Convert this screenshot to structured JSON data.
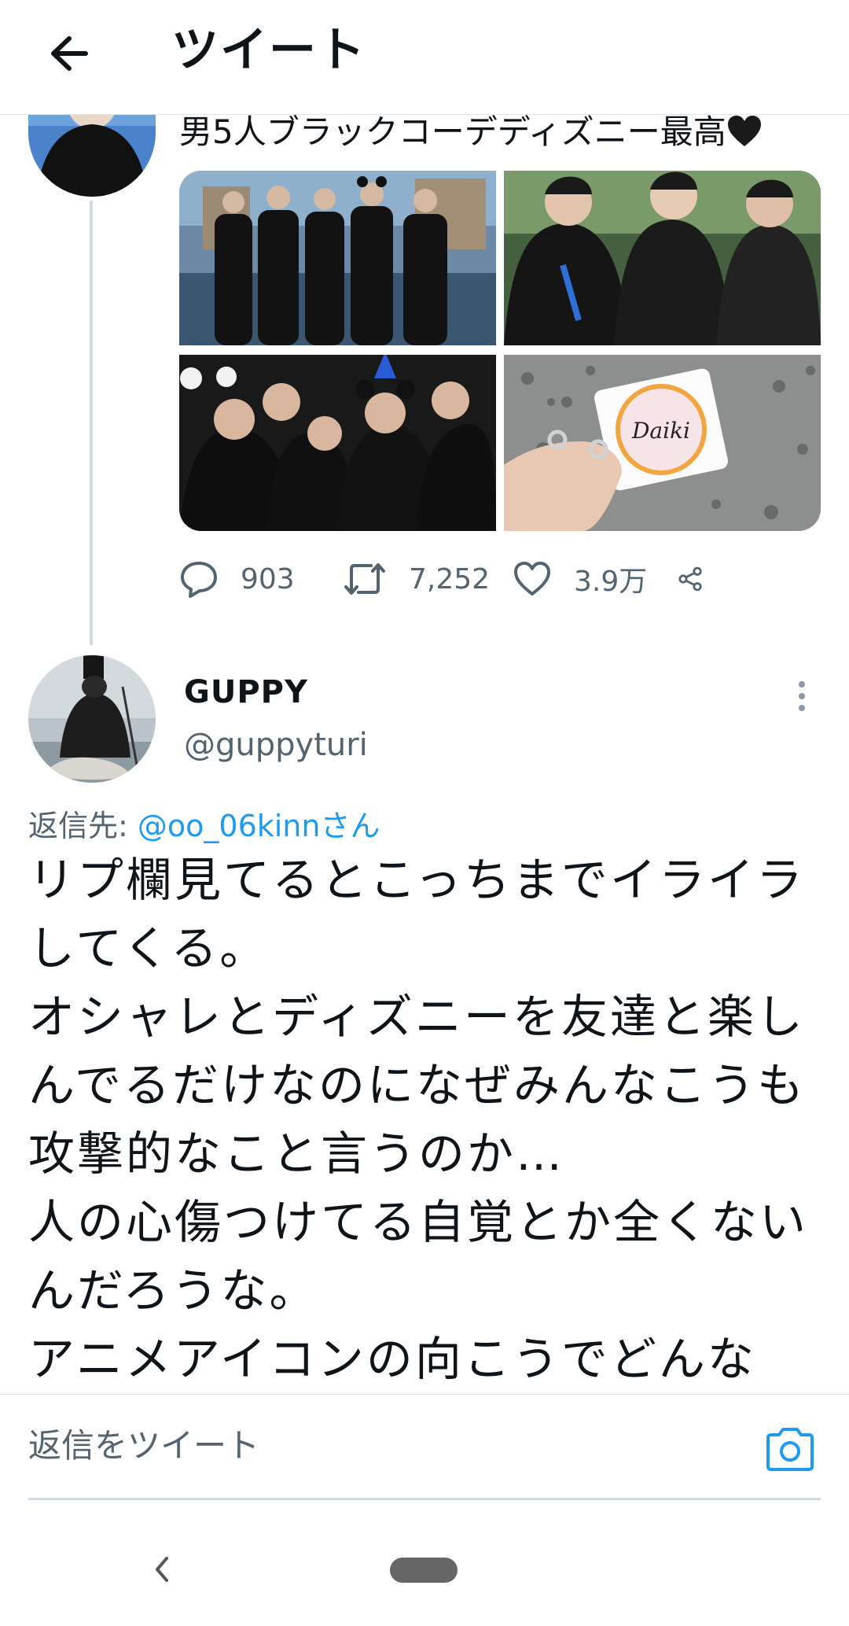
{
  "header": {
    "title": "ツイート",
    "back_icon": "arrow-left-icon"
  },
  "tweet1": {
    "text": "男5人ブラックコーデディズニー最高",
    "emoji": "black-heart",
    "media_count": 4,
    "photo_label": "Daiki",
    "actions": {
      "replies": "903",
      "retweets": "7,252",
      "likes": "3.9万"
    }
  },
  "tweet2": {
    "display_name": "GUPPY",
    "handle": "@guppyturi",
    "replying_prefix": "返信先: ",
    "replying_to": "@oo_06kinnさん",
    "text": "リプ欄見てるとこっちまでイライラしてくる。\nオシャレとディズニーを友達と楽しんでるだけなのになぜみんなこうも攻撃的なこと言うのか…\n人の心傷つけてる自覚とか全くないんだろうな。\nアニメアイコンの向こうでどんな"
  },
  "reply_bar": {
    "placeholder": "返信をツイート",
    "icon": "camera-icon"
  },
  "colors": {
    "accent": "#1d9bf0",
    "secondary_text": "#536471",
    "divider": "#cfd9de"
  }
}
